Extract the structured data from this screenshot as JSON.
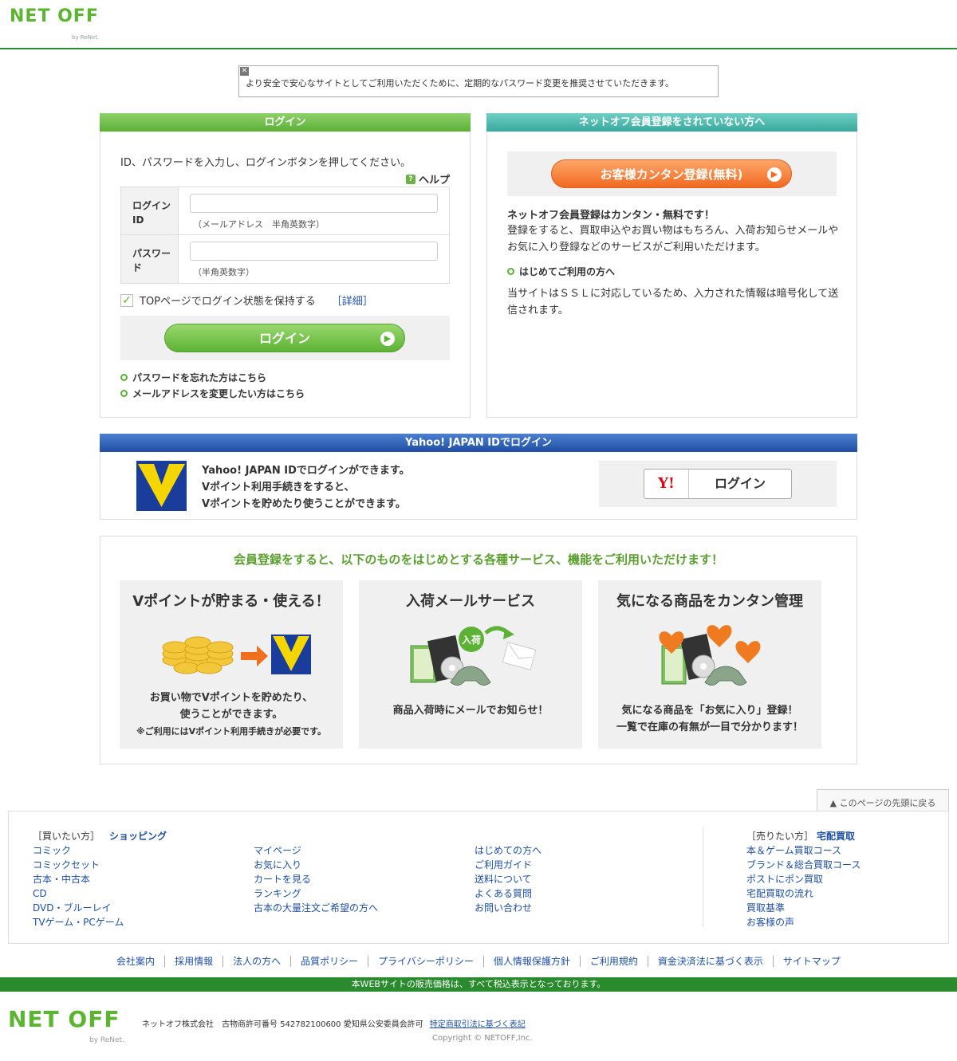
{
  "header": {
    "logo_text": "NET OFF",
    "logo_by": "by ReNet."
  },
  "notice": {
    "message": "より安全で安心なサイトとしてご利用いただくために、定期的なパスワード変更を推奨させていただきます。"
  },
  "login": {
    "title": "ログイン",
    "instruction": "ID、パスワードを入力し、ログインボタンを押してください。",
    "help": "ヘルプ",
    "id_label": "ログインID",
    "id_hint": "（メールアドレス　半角英数字）",
    "pw_label": "パスワード",
    "pw_hint": "（半角英数字）",
    "keep_label": "TOPページでログイン状態を保持する",
    "detail_link": "［詳細］",
    "button": "ログイン",
    "forgot": "パスワードを忘れた方はこちら",
    "change_email": "メールアドレスを変更したい方はこちら"
  },
  "register": {
    "title": "ネットオフ会員登録をされていない方へ",
    "button": "お客様カンタン登録(無料)",
    "headline": "ネットオフ会員登録はカンタン・無料です！",
    "desc": "登録をすると、買取申込やお買い物はもちろん、入荷お知らせメールやお気に入り登録などのサービスがご利用いただけます。",
    "first_time": "はじめてご利用の方へ",
    "ssl": "当サイトはＳＳＬに対応しているため、入力された情報は暗号化して送信されます。"
  },
  "yahoo": {
    "title": "Yahoo! JAPAN IDでログイン",
    "line1": "Yahoo! JAPAN IDでログインができます。",
    "line2": "Vポイント利用手続きをすると、",
    "line3": "Vポイントを貯めたり使うことができます。",
    "y_mark": "Y!",
    "button": "ログイン"
  },
  "features": {
    "title": "会員登録をすると、以下のものをはじめとする各種サービス、機能をご利用いただけます！",
    "cards": [
      {
        "title": "Vポイントが貯まる・使える！",
        "line1": "お買い物でVポイントを貯めたり、",
        "line2": "使うことができます。",
        "note": "※ご利用にはVポイント利用手続きが必要です。"
      },
      {
        "title": "入荷メールサービス",
        "badge": "入荷",
        "line1": "商品入荷時にメールでお知らせ！"
      },
      {
        "title": "気になる商品をカンタン管理",
        "line1": "気になる商品を「お気に入り」登録！",
        "line2": "一覧で在庫の有無が一目で分かります！"
      }
    ]
  },
  "back_to_top": "▲ このページの先頭に戻る",
  "footer": {
    "buy_tag": "［買いたい方］",
    "buy_title": "ショッピング",
    "col1": [
      "コミック",
      "コミックセット",
      "古本・中古本",
      "CD",
      "DVD・ブルーレイ",
      "TVゲーム・PCゲーム"
    ],
    "col2": [
      "マイページ",
      "お気に入り",
      "カートを見る",
      "ランキング",
      "古本の大量注文ご希望の方へ"
    ],
    "col3": [
      "はじめての方へ",
      "ご利用ガイド",
      "送料について",
      "よくある質問",
      "お問い合わせ"
    ],
    "sell_tag": "［売りたい方］",
    "sell_title": "宅配買取",
    "col4": [
      "本＆ゲーム買取コース",
      "ブランド＆総合買取コース",
      "ポストにポン買取",
      "宅配買取の流れ",
      "買取基準",
      "お客様の声"
    ],
    "links": [
      "会社案内",
      "採用情報",
      "法人の方へ",
      "品質ポリシー",
      "プライバシーポリシー",
      "個人情報保護方針",
      "ご利用規約",
      "資金決済法に基づく表示",
      "サイトマップ"
    ],
    "tax": "本WEBサイトの販売価格は、すべて税込表示となっております。",
    "company": "ネットオフ株式会社　古物商許可番号 542782100600 愛知県公安委員会許可",
    "tokutei": "特定商取引法に基づく表記",
    "copyright": "Copyright © NETOFF,Inc."
  }
}
